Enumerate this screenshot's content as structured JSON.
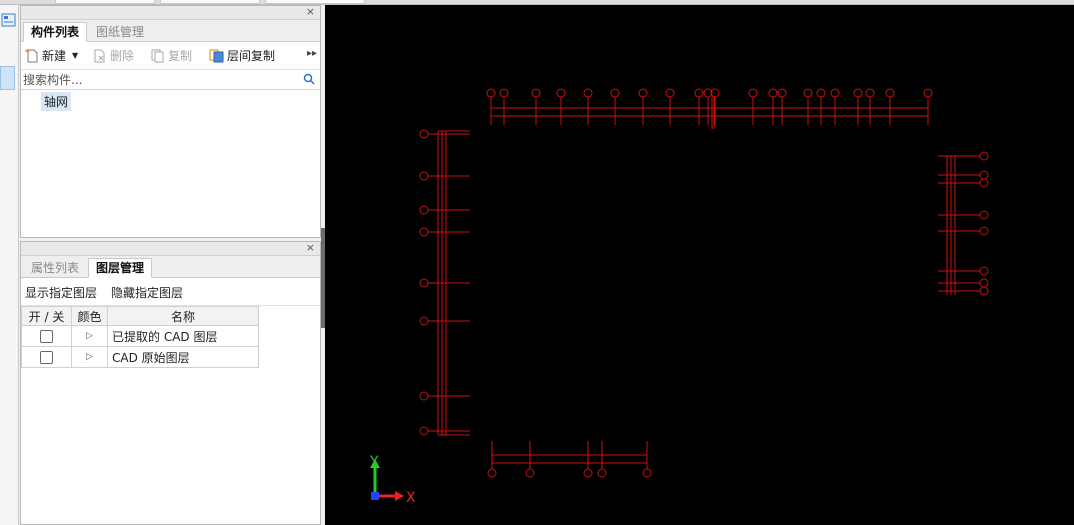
{
  "component_panel": {
    "tabs": [
      {
        "label": "构件列表",
        "active": true
      },
      {
        "label": "图纸管理",
        "active": false
      }
    ],
    "toolbar": {
      "new_label": "新建",
      "delete_label": "删除",
      "copy_label": "复制",
      "floor_copy_label": "层间复制"
    },
    "search": {
      "placeholder": "搜索构件..."
    },
    "tree": [
      {
        "label": "轴网"
      }
    ]
  },
  "layer_panel": {
    "tabs": [
      {
        "label": "属性列表",
        "active": false
      },
      {
        "label": "图层管理",
        "active": true
      }
    ],
    "show_layer_label": "显示指定图层",
    "hide_layer_label": "隐藏指定图层",
    "columns": [
      "开 / 关",
      "颜色",
      "名称"
    ],
    "rows": [
      {
        "name": "已提取的 CAD 图层",
        "checked": false
      },
      {
        "name": "CAD 原始图层",
        "checked": false
      }
    ]
  },
  "axis_indicator": {
    "y_label": "Y",
    "x_label": "X",
    "y_color": "#22cc22",
    "x_color": "#ee2222",
    "origin_color": "#2244ff"
  },
  "cad_color": "#cc1111"
}
